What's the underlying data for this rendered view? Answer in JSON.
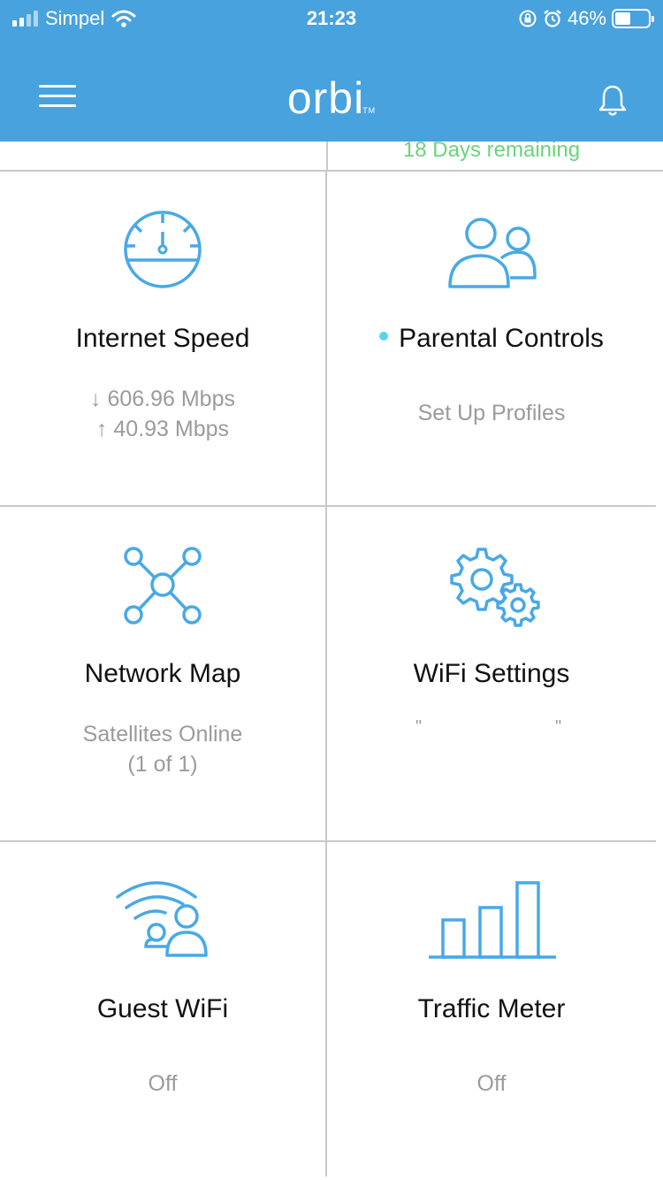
{
  "status_bar": {
    "carrier": "Simpel",
    "time": "21:23",
    "battery": "46%"
  },
  "nav": {
    "logo": "orbi",
    "trademark": "TM"
  },
  "banner": {
    "remaining": "18 Days remaining"
  },
  "tiles": [
    {
      "title": "Internet Speed",
      "download": "↓ 606.96 Mbps",
      "upload": "↑ 40.93 Mbps"
    },
    {
      "title": "Parental Controls",
      "subtitle": "Set Up Profiles"
    },
    {
      "title": "Network Map",
      "subtitle_line1": "Satellites Online",
      "subtitle_line2": "(1 of 1)"
    },
    {
      "title": "WiFi Settings",
      "quote_left": "\"",
      "quote_right": "\""
    },
    {
      "title": "Guest WiFi",
      "subtitle": "Off"
    },
    {
      "title": "Traffic Meter",
      "subtitle": "Off"
    }
  ],
  "colors": {
    "header": "#48a2dd",
    "icon": "#48a9e6",
    "remaining_text": "#6bd37d",
    "dot": "#5ad2f4"
  }
}
